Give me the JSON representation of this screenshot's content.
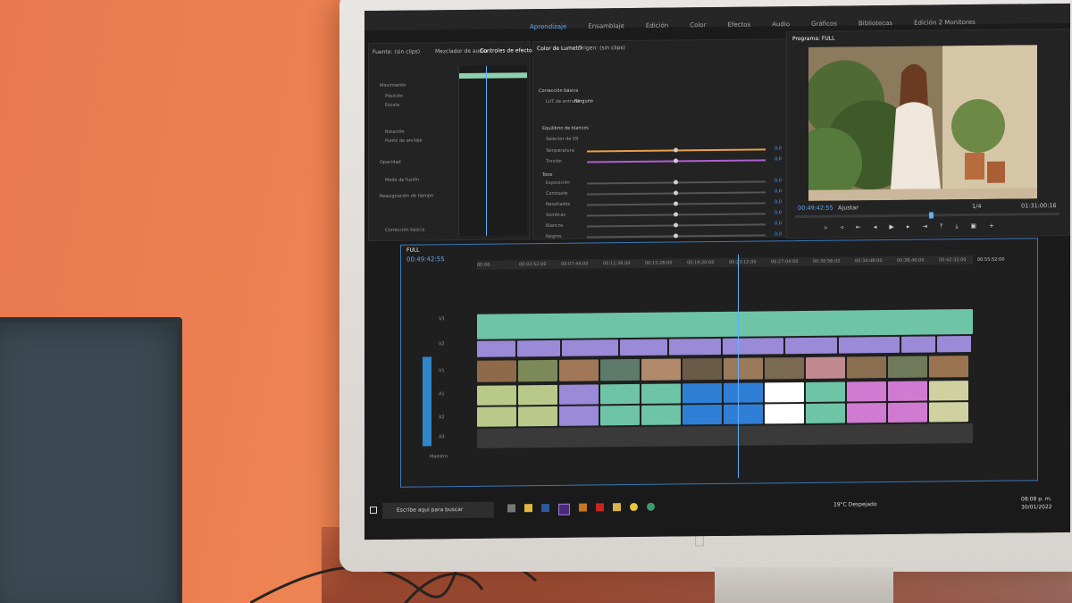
{
  "workspace_tabs": [
    "Aprendizaje",
    "Ensamblaje",
    "Edición",
    "Color",
    "Efectos",
    "Audio",
    "Gráficos",
    "Bibliotecas",
    "Edición 2 Monitores"
  ],
  "source_panel": {
    "tabs": [
      "Fuente: (sin clips)",
      "Mezclador de audio",
      "Controles de efectos"
    ],
    "effect_controls": [
      "Movimiento",
      "Posición",
      "Escala",
      "Rotación",
      "Punto de anclaje",
      "Opacidad",
      "Modo de fusión",
      "Reasignación de tiempo",
      "Corrección básica"
    ]
  },
  "lumetri": {
    "title": "Color de Lumetri",
    "source_tab": "Origen: (sin clips)",
    "section": "Corrección básica",
    "lut_label": "LUT de entrada",
    "lut_value": "Ninguno",
    "white_balance": "Equilibrio de blancos",
    "wb_selector": "Selector de EB",
    "controls": [
      {
        "label": "Temperatura",
        "value": "0,0",
        "color": "#e9a046"
      },
      {
        "label": "Tinción",
        "value": "0,0",
        "color": "#b05fd0"
      },
      {
        "label": "Exposición",
        "value": "0,0"
      },
      {
        "label": "Contraste",
        "value": "0,0"
      },
      {
        "label": "Resaltados",
        "value": "0,0"
      },
      {
        "label": "Sombras",
        "value": "0,0"
      },
      {
        "label": "Blancos",
        "value": "0,0"
      },
      {
        "label": "Negros",
        "value": "0,0"
      }
    ],
    "tone": "Tono"
  },
  "program": {
    "title": "Programa: FULL",
    "timecode_current": "00:49:42:55",
    "fit": "Ajustar",
    "scale": "1/4",
    "timecode_total": "01:31:00:16"
  },
  "timeline": {
    "tab": "FULL",
    "timecode": "00:49:42:55",
    "ruler": [
      "00:00",
      "00:03:52:00",
      "00:07:44:00",
      "00:11:36:00",
      "00:15:28:00",
      "00:19:20:00",
      "00:23:12:00",
      "00:27:04:00",
      "00:30:56:00",
      "00:34:48:00",
      "00:38:40:00",
      "00:42:32:00"
    ],
    "end_time": "00:55:52:00",
    "tracks": [
      "V3",
      "V2",
      "V1",
      "A1",
      "A2",
      "A3",
      "Maestro"
    ]
  },
  "taskbar": {
    "search_placeholder": "Escribe aquí para buscar",
    "weather": "19°C Despejado",
    "time": "08:08 p. m.",
    "date": "30/01/2022"
  },
  "colors": {
    "accent": "#59a9ff",
    "v1": "#6ec4a6",
    "v2": "#9a8ad8",
    "audio_green": "#b9c98a",
    "audio_blue": "#2f7fd6",
    "audio_pink": "#d07ad2"
  }
}
